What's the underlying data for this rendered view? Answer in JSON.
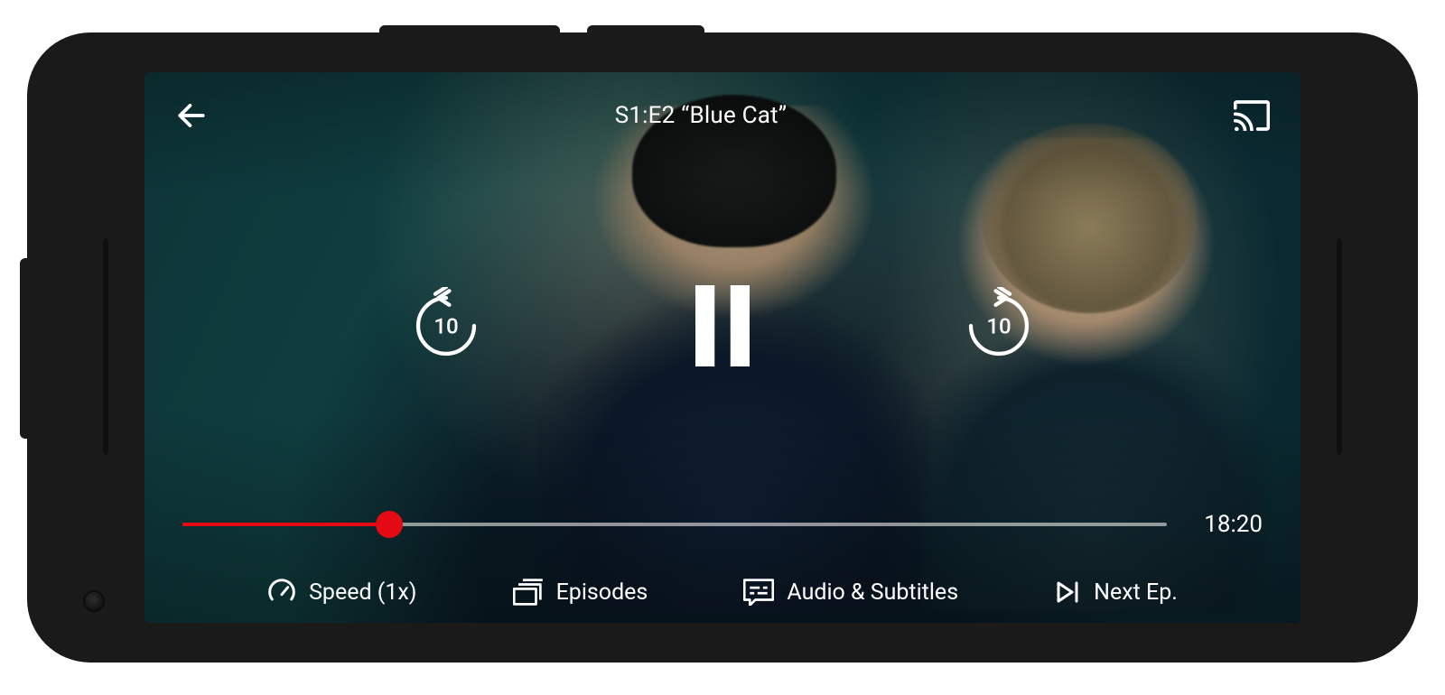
{
  "colors": {
    "accent": "#e50914"
  },
  "player": {
    "title": "S1:E2 “Blue Cat”",
    "skip_seconds": "10",
    "progress_percent": 21,
    "time_remaining": "18:20"
  },
  "controls": {
    "speed_label": "Speed (1x)",
    "episodes_label": "Episodes",
    "audio_label": "Audio & Subtitles",
    "next_label": "Next Ep."
  }
}
